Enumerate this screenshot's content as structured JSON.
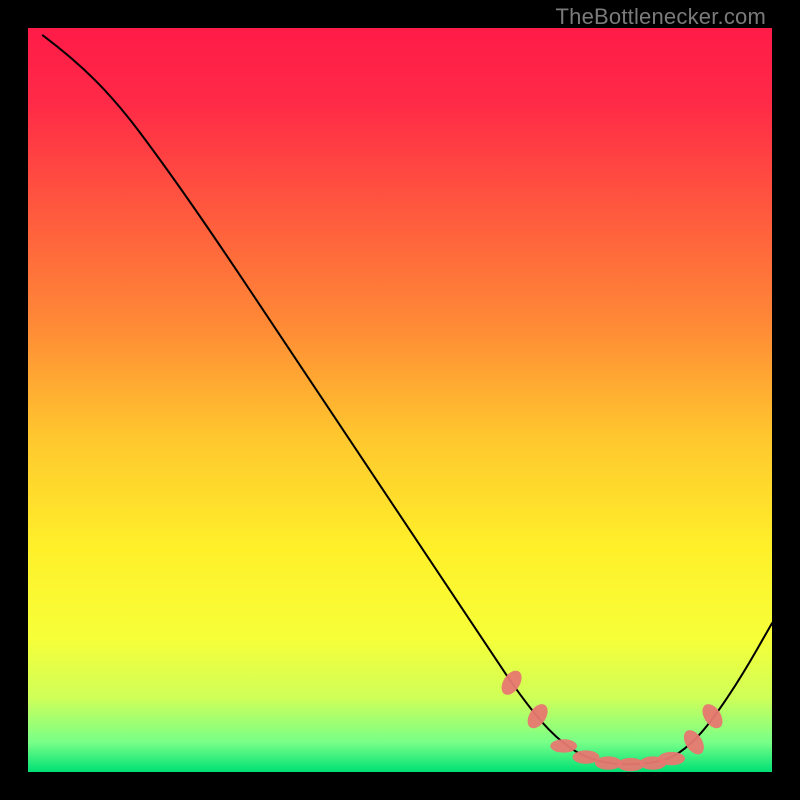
{
  "watermark": "TheBottlenecker.com",
  "chart_data": {
    "type": "line",
    "title": "",
    "xlabel": "",
    "ylabel": "",
    "xlim": [
      0,
      100
    ],
    "ylim": [
      0,
      100
    ],
    "background_gradient": {
      "stops": [
        {
          "offset": 0.0,
          "color": "#ff1b48"
        },
        {
          "offset": 0.1,
          "color": "#ff2a47"
        },
        {
          "offset": 0.25,
          "color": "#ff5a3e"
        },
        {
          "offset": 0.4,
          "color": "#ff8a36"
        },
        {
          "offset": 0.55,
          "color": "#ffc72e"
        },
        {
          "offset": 0.7,
          "color": "#fff02a"
        },
        {
          "offset": 0.82,
          "color": "#f6ff38"
        },
        {
          "offset": 0.9,
          "color": "#cfff58"
        },
        {
          "offset": 0.96,
          "color": "#78ff88"
        },
        {
          "offset": 1.0,
          "color": "#00e074"
        }
      ]
    },
    "curve": [
      {
        "x": 2.0,
        "y": 99.0
      },
      {
        "x": 6.0,
        "y": 96.0
      },
      {
        "x": 12.0,
        "y": 90.0
      },
      {
        "x": 18.0,
        "y": 82.0
      },
      {
        "x": 25.0,
        "y": 72.0
      },
      {
        "x": 35.0,
        "y": 57.0
      },
      {
        "x": 45.0,
        "y": 42.0
      },
      {
        "x": 55.0,
        "y": 27.0
      },
      {
        "x": 62.0,
        "y": 16.5
      },
      {
        "x": 66.0,
        "y": 10.5
      },
      {
        "x": 70.0,
        "y": 5.5
      },
      {
        "x": 74.0,
        "y": 2.3
      },
      {
        "x": 78.0,
        "y": 1.1
      },
      {
        "x": 82.0,
        "y": 1.0
      },
      {
        "x": 86.0,
        "y": 1.6
      },
      {
        "x": 89.0,
        "y": 3.6
      },
      {
        "x": 92.0,
        "y": 7.0
      },
      {
        "x": 96.0,
        "y": 13.0
      },
      {
        "x": 100.0,
        "y": 20.0
      }
    ],
    "markers": [
      {
        "x": 65.0,
        "y": 12.0,
        "shape": "ellipse-steep"
      },
      {
        "x": 68.5,
        "y": 7.5,
        "shape": "ellipse-steep"
      },
      {
        "x": 72.0,
        "y": 3.5,
        "shape": "ellipse-flat"
      },
      {
        "x": 75.0,
        "y": 2.0,
        "shape": "ellipse-flat"
      },
      {
        "x": 78.0,
        "y": 1.2,
        "shape": "ellipse-flat"
      },
      {
        "x": 81.0,
        "y": 1.0,
        "shape": "ellipse-flat"
      },
      {
        "x": 84.0,
        "y": 1.2,
        "shape": "ellipse-flat"
      },
      {
        "x": 86.5,
        "y": 1.8,
        "shape": "ellipse-flat"
      },
      {
        "x": 89.5,
        "y": 4.0,
        "shape": "ellipse-steep-r"
      },
      {
        "x": 92.0,
        "y": 7.5,
        "shape": "ellipse-steep-r"
      }
    ],
    "marker_style": {
      "fill": "#e77871",
      "rx_flat": 1.8,
      "ry_flat": 0.9,
      "rx_steep": 1.1,
      "ry_steep": 1.8
    }
  }
}
